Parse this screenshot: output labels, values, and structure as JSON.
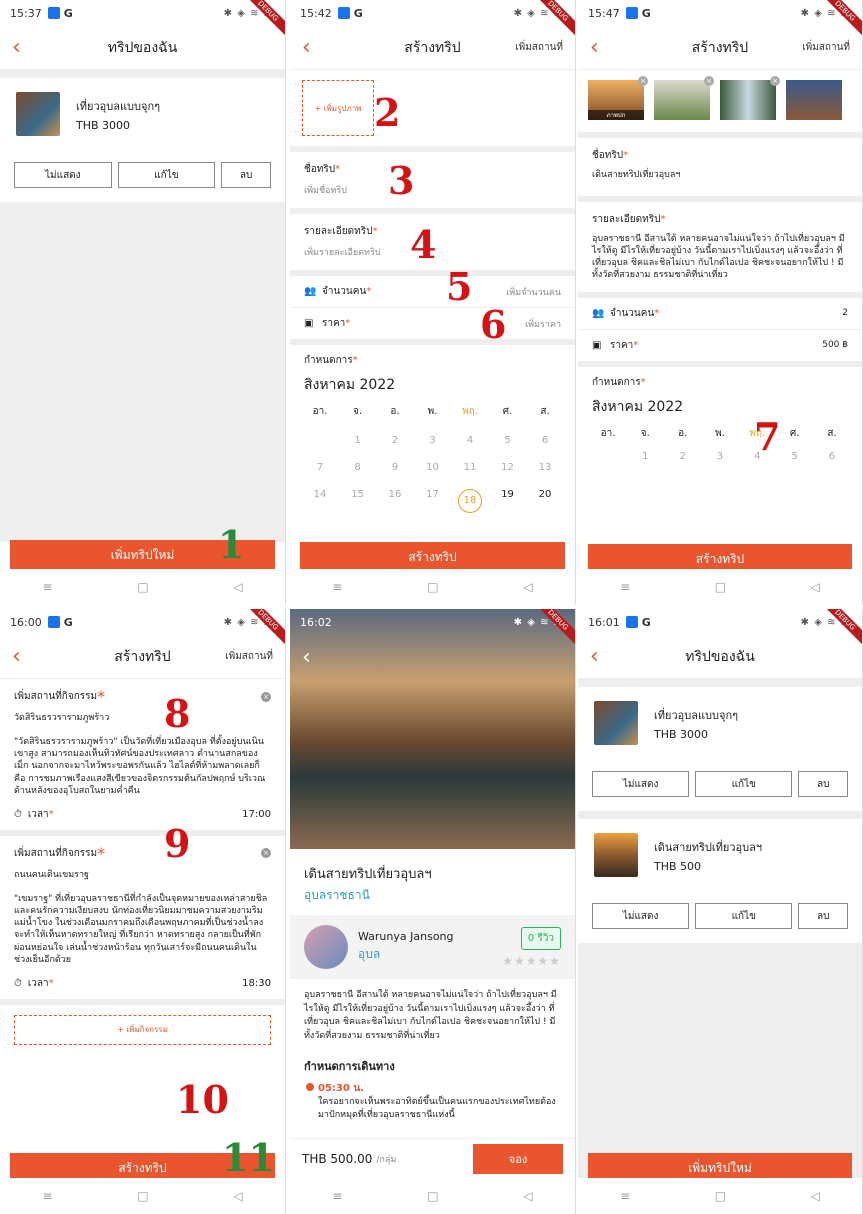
{
  "status": {
    "s1": "15:37",
    "s2": "15:42",
    "s3": "15:47",
    "s4": "16:00",
    "s5": "16:02",
    "s6": "16:01",
    "g": "G",
    "icons": "✱ ◈ ≋ ıll",
    "debug": "DEBUG"
  },
  "my_trips": {
    "title": "ทริปของฉัน",
    "btn_hide": "ไม่แสดง",
    "btn_edit": "แก้ไข",
    "btn_delete": "ลบ",
    "add_new": "เพิ่มทริปใหม่",
    "trips": [
      {
        "name": "เที่ยวอุบลแบบจุกๆ",
        "price": "THB 3000"
      },
      {
        "name": "เดินสายทริปเที่ยวอุบลฯ",
        "price": "THB 500"
      }
    ]
  },
  "create": {
    "title": "สร้างทริป",
    "add_place": "เพิ่มสถานที่",
    "add_image": "+ เพิ่มรูปภาพ",
    "trip_name_label": "ชื่อทริป",
    "trip_name_ph": "เพิ่มชื่อทริป",
    "detail_label": "รายละเอียดทริป",
    "detail_ph": "เพิ่มรายละเอียดทริป",
    "people_label": "จำนวนคน",
    "people_ph": "เพิ่มจำนวนคน",
    "price_label": "ราคา",
    "price_ph": "เพิ่มราคา",
    "schedule_label": "กำหนดการ",
    "submit": "สร้างทริป",
    "trip_name_val": "เดินสายทริปเที่ยวอุบลฯ",
    "detail_val": "อุบลราชธานี อีสานใต้ หลายคนอาจไม่แน่ใจว่า ถ้าไปเที่ยวอุบลฯ มีไรให้ดู มีไรให้เที่ยวอยู่บ้าง วันนี้ตามเราไปเบิ่งแรงๆ แล้วจะอึ้งว่า ที่เที่ยวอุบล ชิคและชิลไม่เบา กับไกด์ไอเปอ ชิคชะจนอยากให้ไป ! มีทั้งวัดที่สวยงาม ธรรมชาติที่น่าเที่ยว",
    "people_val": "2",
    "price_val": "500 ฿",
    "img_cap": "ภาพปก",
    "req": "*"
  },
  "calendar": {
    "month": "สิงหาคม 2022",
    "dow": [
      "อา.",
      "จ.",
      "อ.",
      "พ.",
      "พฤ.",
      "ศ.",
      "ส."
    ],
    "w1": [
      "",
      "1",
      "2",
      "3",
      "4",
      "5",
      "6"
    ],
    "w2": [
      "7",
      "8",
      "9",
      "10",
      "11",
      "12",
      "13"
    ],
    "w3": [
      "14",
      "15",
      "16",
      "17",
      "18",
      "19",
      "20"
    ]
  },
  "activity": {
    "label": "เพิ่มสถานที่กิจกรรม",
    "place1": "วัดสิรินธรวรารามภูพร้าว",
    "desc1": "\"วัดสิรินธรวรารามภูพร้าว\" เป็นวัดที่เที่ยวเมืองอุบล ที่ตั้งอยู่บนเนินเขาสูง สามารถมองเห็นทิวทัศน์ของประเทศลาว ตำนานสกลของเม็ก นอกจากจะมาไหว้พระขอพรกันแล้ว ไฮไลต์ที่ห้ามพลาดเลยก็คือ การชมภาพเรืองแสงสีเขียวของจิตรกรรมต้นกัลปพฤกษ์ บริเวณด้านหลังของอุโบสถในยามค่ำคืน",
    "time_label": "เวลา",
    "time1": "17:00",
    "place2": "ถนนคนเดินเขมราฐ",
    "desc2": "\"เขมราฐ\" ที่เที่ยวอุบลราชธานีที่กำลังเป็นจุดหมายของเหล่าสายชิลและคนรักความเงียบสงบ นักท่องเที่ยวนิยมมาชมความสวยงามริมแม่น้ำโขง ในช่วงเดือนมกราคมถึงเดือนพฤษภาคมที่เป็นช่วงน้ำลง จะทำให้เห็นหาดทรายใหญ่ ที่เรียกว่า หาดทรายสูง กลายเป็นที่พักผ่อนหย่อนใจ เล่นน้ำช่วงหน้าร้อน ทุกวันเสาร์จะมีถนนคนเดินในช่วงเย็นอีกด้วย",
    "time2": "18:30",
    "add_activity": "+ เพิ่มกิจกรรม"
  },
  "detail": {
    "title": "เดินสายทริปเที่ยวอุบลฯ",
    "province": "อุบลราชธานี",
    "host": "Warunya Jansong",
    "host_city": "อุบล",
    "reviews": "0 รีวิว",
    "stars": "★★★★★",
    "plan_label": "กำหนดการเดินทาง",
    "tl_time": "05:30 น.",
    "tl_text": "ใครอยากจะเห็นพระอาทิตย์ขึ้นเป็นคนแรกของประเทศไทยต้องมาปักหมุดที่เที่ยวอุบลราชธานีแห่งนี้",
    "price": "THB 500.00",
    "unit": "/กลุ่ม",
    "book": "จอง"
  },
  "markers": {
    "m1": "1",
    "m2": "2",
    "m3": "3",
    "m4": "4",
    "m5": "5",
    "m6": "6",
    "m7": "7",
    "m8": "8",
    "m9": "9",
    "m10": "10",
    "m11": "11"
  },
  "nav": {
    "menu": "≡",
    "home": "□",
    "back": "◁"
  },
  "icons": {
    "back": "‹",
    "people": "👥",
    "price": "▣",
    "clock": "⏱",
    "close": "×"
  }
}
